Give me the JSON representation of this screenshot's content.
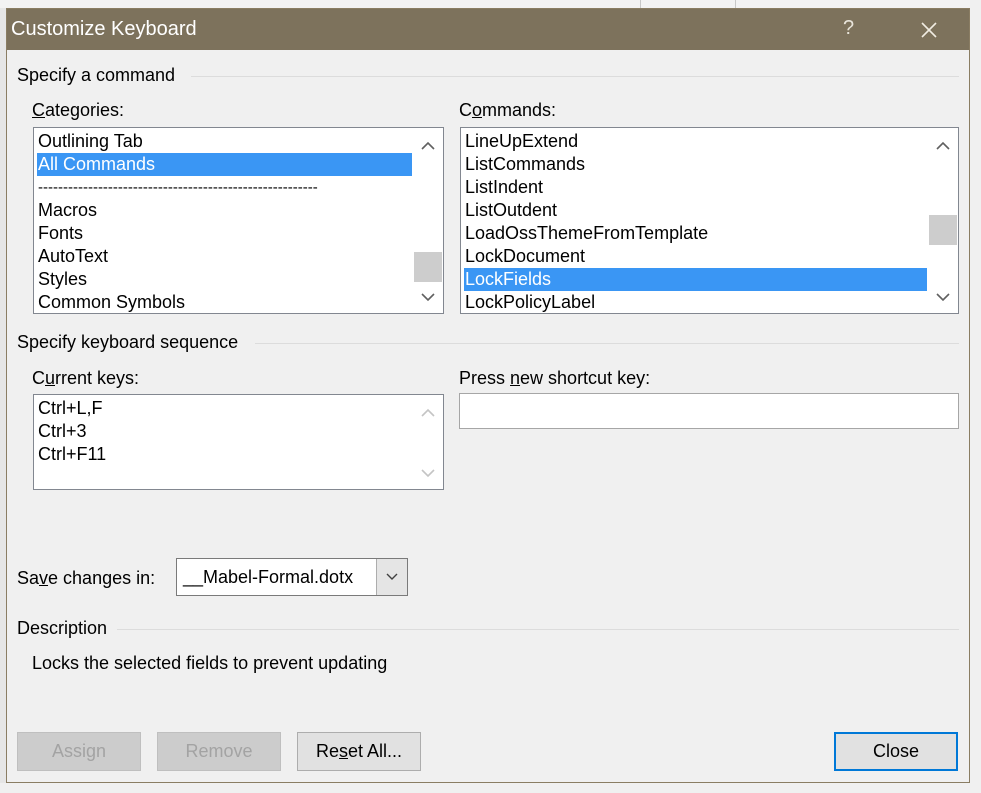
{
  "dialog": {
    "title": "Customize Keyboard",
    "help_glyph": "?",
    "close_icon": "close-icon"
  },
  "command_section": {
    "heading": "Specify a command",
    "categories": {
      "label_accel": "C",
      "label_rest": "ategories:",
      "items": [
        "Outlining Tab",
        "All Commands",
        "--------------------------------------------------------",
        "Macros",
        "Fonts",
        "AutoText",
        "Styles",
        "Common Symbols"
      ],
      "selected": "All Commands"
    },
    "commands": {
      "label_pre": "C",
      "label_accel": "o",
      "label_rest": "mmands:",
      "items": [
        "LineUpExtend",
        "ListCommands",
        "ListIndent",
        "ListOutdent",
        "LoadOssThemeFromTemplate",
        "LockDocument",
        "LockFields",
        "LockPolicyLabel"
      ],
      "selected": "LockFields"
    }
  },
  "keyboard_section": {
    "heading": "Specify keyboard sequence",
    "current_keys": {
      "label_pre": "C",
      "label_accel": "u",
      "label_rest": "rrent keys:",
      "items": [
        "Ctrl+L,F",
        "Ctrl+3",
        "Ctrl+F11"
      ]
    },
    "new_shortcut": {
      "label_pre": "Press ",
      "label_accel": "n",
      "label_rest": "ew shortcut key:",
      "value": ""
    }
  },
  "save_in": {
    "label_pre": "Sa",
    "label_accel": "v",
    "label_rest": "e changes in:",
    "value": "__Mabel-Formal.dotx"
  },
  "description": {
    "heading": "Description",
    "text": "Locks the selected fields to prevent updating"
  },
  "buttons": {
    "assign": "Assign",
    "remove": "Remove",
    "reset_pre": "Re",
    "reset_accel": "s",
    "reset_rest": "et All...",
    "close": "Close"
  },
  "colors": {
    "titlebar": "#7d725c",
    "selection": "#3a96f4",
    "default_button_border": "#0078d7"
  }
}
